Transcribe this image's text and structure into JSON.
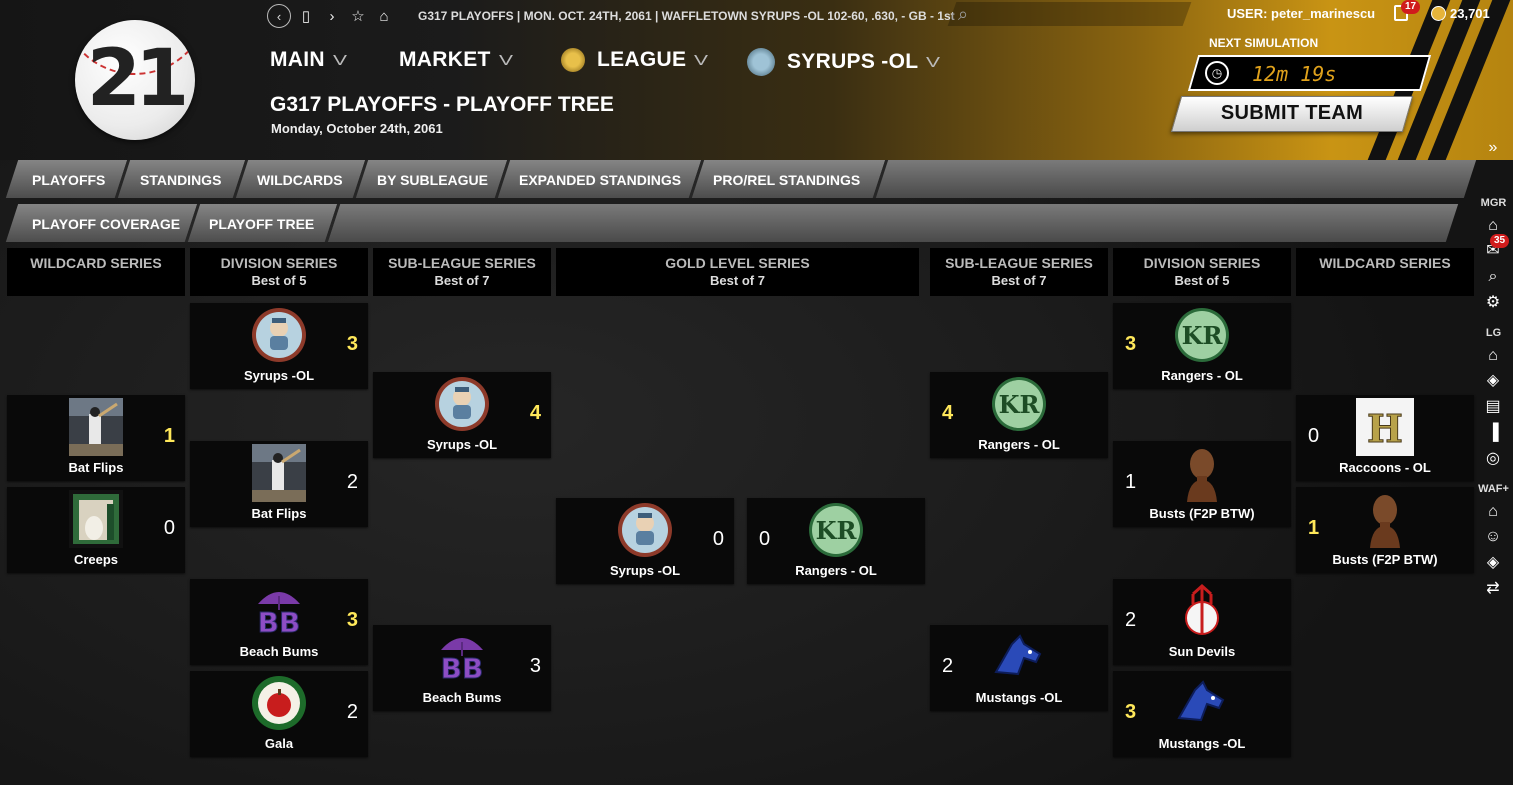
{
  "header": {
    "logo_text": "21",
    "breadcrumb": "G317 PLAYOFFS  |  MON. OCT. 24TH, 2061  |  WAFFLETOWN SYRUPS -OL   102-60, .630, - GB - 1st",
    "user": "USER: peter_marinescu",
    "notifications": "17",
    "coins": "23,701",
    "menus": [
      "MAIN",
      "MARKET",
      "LEAGUE",
      "SYRUPS -OL"
    ],
    "title": "G317 PLAYOFFS - PLAYOFF TREE",
    "date": "Monday, October 24th, 2061",
    "sim_label": "NEXT SIMULATION",
    "sim_time": "12m 19s",
    "submit": "SUBMIT TEAM"
  },
  "tabs": [
    "PLAYOFFS",
    "STANDINGS",
    "WILDCARDS",
    "BY SUBLEAGUE",
    "EXPANDED STANDINGS",
    "PRO/REL STANDINGS"
  ],
  "subtabs": [
    "PLAYOFF COVERAGE",
    "PLAYOFF TREE"
  ],
  "rail": {
    "mgr": "MGR",
    "lg": "LG",
    "waf": "WAF+",
    "mail_badge": "35",
    "collapse": "»"
  },
  "columns": [
    {
      "title": "WILDCARD SERIES",
      "sub": ""
    },
    {
      "title": "DIVISION SERIES",
      "sub": "Best of 5"
    },
    {
      "title": "SUB-LEAGUE SERIES",
      "sub": "Best of 7"
    },
    {
      "title": "GOLD LEVEL SERIES",
      "sub": "Best of 7"
    },
    {
      "title": "SUB-LEAGUE SERIES",
      "sub": "Best of 7"
    },
    {
      "title": "DIVISION SERIES",
      "sub": "Best of 5"
    },
    {
      "title": "WILDCARD SERIES",
      "sub": ""
    }
  ],
  "matchups": [
    {
      "team": "Bat Flips",
      "score": "1",
      "winner": true,
      "logo": "batflips"
    },
    {
      "team": "Creeps",
      "score": "0",
      "winner": false,
      "logo": "creeps"
    },
    {
      "team": "Syrups -OL",
      "score": "3",
      "winner": true,
      "logo": "syrups"
    },
    {
      "team": "Bat Flips",
      "score": "2",
      "winner": false,
      "logo": "batflips"
    },
    {
      "team": "Beach Bums",
      "score": "3",
      "winner": true,
      "logo": "beachbums"
    },
    {
      "team": "Gala",
      "score": "2",
      "winner": false,
      "logo": "gala"
    },
    {
      "team": "Syrups -OL",
      "score": "4",
      "winner": true,
      "logo": "syrups"
    },
    {
      "team": "Beach Bums",
      "score": "3",
      "winner": false,
      "logo": "beachbums"
    },
    {
      "team": "Syrups -OL",
      "score": "0",
      "winner": false,
      "logo": "syrups"
    },
    {
      "team": "Rangers - OL",
      "score": "0",
      "winner": false,
      "logo": "rangers"
    },
    {
      "team": "Rangers - OL",
      "score": "4",
      "winner": true,
      "logo": "rangers"
    },
    {
      "team": "Mustangs -OL",
      "score": "2",
      "winner": false,
      "logo": "mustangs"
    },
    {
      "team": "Rangers - OL",
      "score": "3",
      "winner": true,
      "logo": "rangers"
    },
    {
      "team": "Busts (F2P BTW)",
      "score": "1",
      "winner": false,
      "logo": "busts"
    },
    {
      "team": "Sun Devils",
      "score": "2",
      "winner": false,
      "logo": "sundevils"
    },
    {
      "team": "Mustangs -OL",
      "score": "3",
      "winner": true,
      "logo": "mustangs"
    },
    {
      "team": "Raccoons - OL",
      "score": "0",
      "winner": false,
      "logo": "raccoons"
    },
    {
      "team": "Busts (F2P BTW)",
      "score": "1",
      "winner": true,
      "logo": "busts"
    }
  ]
}
